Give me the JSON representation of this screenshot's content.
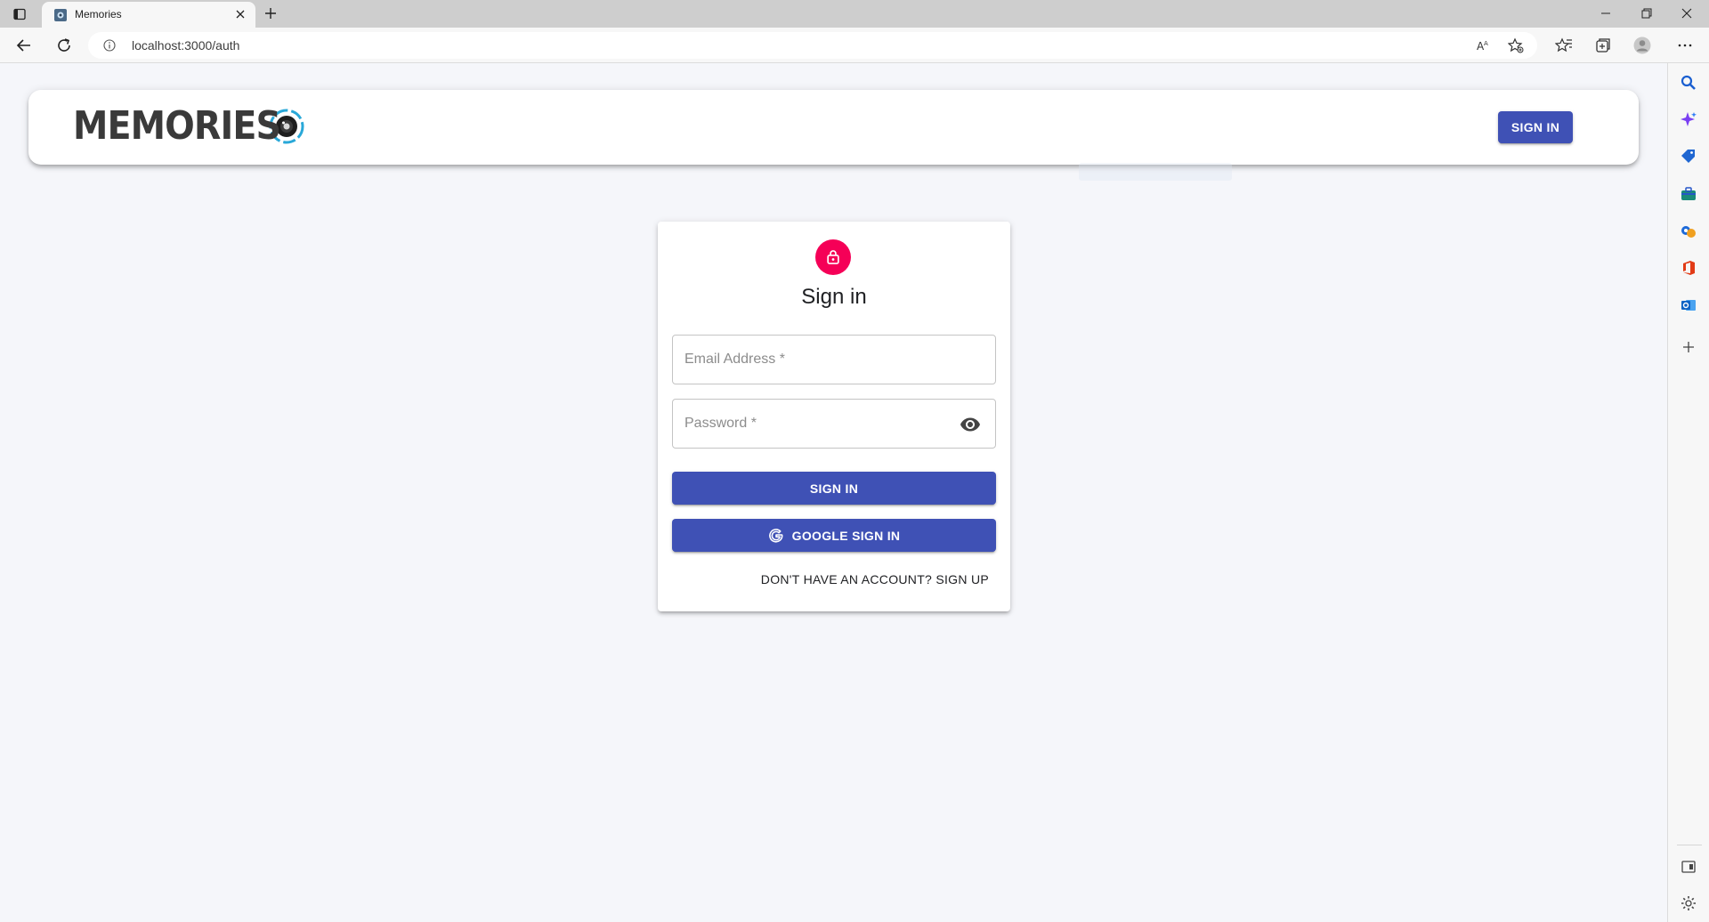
{
  "browser": {
    "tab_title": "Memories",
    "url": "localhost:3000/auth"
  },
  "header": {
    "brand": "MEMORIES",
    "sign_in_label": "SIGN IN"
  },
  "auth_form": {
    "title": "Sign in",
    "email_placeholder": "Email Address *",
    "password_placeholder": "Password *",
    "submit_label": "SIGN IN",
    "google_label": "GOOGLE SIGN IN",
    "switch_label": "DON'T HAVE AN ACCOUNT? SIGN UP"
  },
  "colors": {
    "primary": "#3f51b5",
    "avatar": "#f50057",
    "page_background": "#f5f6fa"
  },
  "icons": {
    "avatar": "lock-icon",
    "password_toggle": "eye-icon",
    "google": "google-g-icon",
    "brand_logo": "camera-lens-icon"
  }
}
